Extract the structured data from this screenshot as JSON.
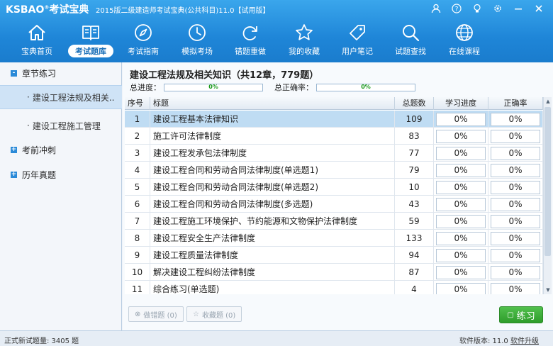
{
  "app": {
    "logo": "KSBAO",
    "logo_sup": "®",
    "logo_cn": "考试宝典",
    "window_title": "2015版二级建造师考试宝典(公共科目)11.0【试用版】"
  },
  "toolbar": [
    {
      "label": "宝典首页",
      "icon": "home-icon"
    },
    {
      "label": "考试题库",
      "icon": "book-icon",
      "active": true
    },
    {
      "label": "考试指南",
      "icon": "compass-icon"
    },
    {
      "label": "模拟考场",
      "icon": "clock-icon"
    },
    {
      "label": "错题重做",
      "icon": "redo-icon"
    },
    {
      "label": "我的收藏",
      "icon": "star-icon"
    },
    {
      "label": "用户笔记",
      "icon": "tag-icon"
    },
    {
      "label": "试题查找",
      "icon": "search-icon"
    },
    {
      "label": "在线课程",
      "icon": "globe-icon"
    }
  ],
  "sidebar": {
    "sections": [
      {
        "label": "章节练习",
        "box": "-"
      },
      {
        "label": "考前冲刺",
        "box": "+"
      },
      {
        "label": "历年真题",
        "box": "+"
      }
    ],
    "items": [
      {
        "label": "建设工程法规及相关..",
        "dot": "·"
      },
      {
        "label": "建设工程施工管理",
        "dot": "·"
      }
    ]
  },
  "main": {
    "subject_title": "建设工程法规及相关知识（共12章，779题）",
    "total_progress_label": "总进度：",
    "total_progress_value": "0%",
    "total_accuracy_label": "总正确率：",
    "total_accuracy_value": "0%",
    "columns": [
      "序号",
      "标题",
      "总题数",
      "学习进度",
      "正确率"
    ],
    "rows": [
      {
        "no": "1",
        "title": "建设工程基本法律知识",
        "count": "109",
        "progress": "0%",
        "accuracy": "0%"
      },
      {
        "no": "2",
        "title": "施工许可法律制度",
        "count": "83",
        "progress": "0%",
        "accuracy": "0%"
      },
      {
        "no": "3",
        "title": "建设工程发承包法律制度",
        "count": "77",
        "progress": "0%",
        "accuracy": "0%"
      },
      {
        "no": "4",
        "title": "建设工程合同和劳动合同法律制度(单选题1)",
        "count": "79",
        "progress": "0%",
        "accuracy": "0%"
      },
      {
        "no": "5",
        "title": "建设工程合同和劳动合同法律制度(单选题2)",
        "count": "10",
        "progress": "0%",
        "accuracy": "0%"
      },
      {
        "no": "6",
        "title": "建设工程合同和劳动合同法律制度(多选题)",
        "count": "43",
        "progress": "0%",
        "accuracy": "0%"
      },
      {
        "no": "7",
        "title": "建设工程施工环境保护、节约能源和文物保护法律制度",
        "count": "59",
        "progress": "0%",
        "accuracy": "0%"
      },
      {
        "no": "8",
        "title": "建设工程安全生产法律制度",
        "count": "133",
        "progress": "0%",
        "accuracy": "0%"
      },
      {
        "no": "9",
        "title": "建设工程质量法律制度",
        "count": "94",
        "progress": "0%",
        "accuracy": "0%"
      },
      {
        "no": "10",
        "title": "解决建设工程纠纷法律制度",
        "count": "87",
        "progress": "0%",
        "accuracy": "0%"
      },
      {
        "no": "11",
        "title": "综合练习(单选题)",
        "count": "4",
        "progress": "0%",
        "accuracy": "0%"
      }
    ],
    "buttons": {
      "wrong": "做错题 (0)",
      "favorite": "收藏题 (0)",
      "practice": "练习"
    }
  },
  "status": {
    "left": "正式新试题量: 3405 题",
    "right_prefix": "软件版本: 11.0",
    "right_link": "软件升级"
  },
  "colors": {
    "toolbar": "#1f86d8",
    "selected_row": "#bfdcf3",
    "practice_button": "#3aa836"
  }
}
